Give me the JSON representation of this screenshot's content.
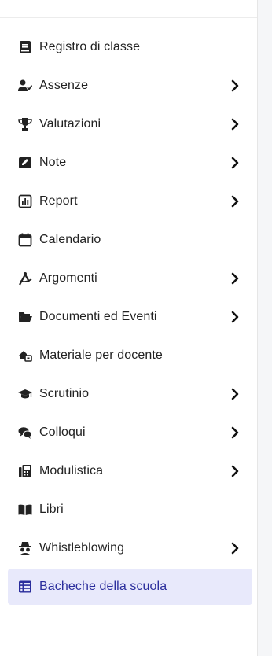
{
  "menu": {
    "items": [
      {
        "label": "Registro di classe",
        "icon": "book-icon",
        "chevron": false
      },
      {
        "label": "Assenze",
        "icon": "user-check-icon",
        "chevron": true
      },
      {
        "label": "Valutazioni",
        "icon": "trophy-icon",
        "chevron": true
      },
      {
        "label": "Note",
        "icon": "note-icon",
        "chevron": true
      },
      {
        "label": "Report",
        "icon": "chart-icon",
        "chevron": true
      },
      {
        "label": "Calendario",
        "icon": "calendar-icon",
        "chevron": false
      },
      {
        "label": "Argomenti",
        "icon": "compass-icon",
        "chevron": true
      },
      {
        "label": "Documenti ed Eventi",
        "icon": "folder-icon",
        "chevron": true
      },
      {
        "label": "Materiale per docente",
        "icon": "house-share-icon",
        "chevron": false
      },
      {
        "label": "Scrutinio",
        "icon": "graduation-cap-icon",
        "chevron": true
      },
      {
        "label": "Colloqui",
        "icon": "chat-icon",
        "chevron": true
      },
      {
        "label": "Modulistica",
        "icon": "fax-icon",
        "chevron": true
      },
      {
        "label": "Libri",
        "icon": "open-book-icon",
        "chevron": false
      },
      {
        "label": "Whistleblowing",
        "icon": "spy-icon",
        "chevron": true
      },
      {
        "label": "Bacheche della scuola",
        "icon": "list-icon",
        "chevron": false,
        "active": true
      }
    ]
  },
  "colors": {
    "text": "#222222",
    "active_text": "#2a2d9c",
    "active_bg": "#e8e9fb"
  }
}
